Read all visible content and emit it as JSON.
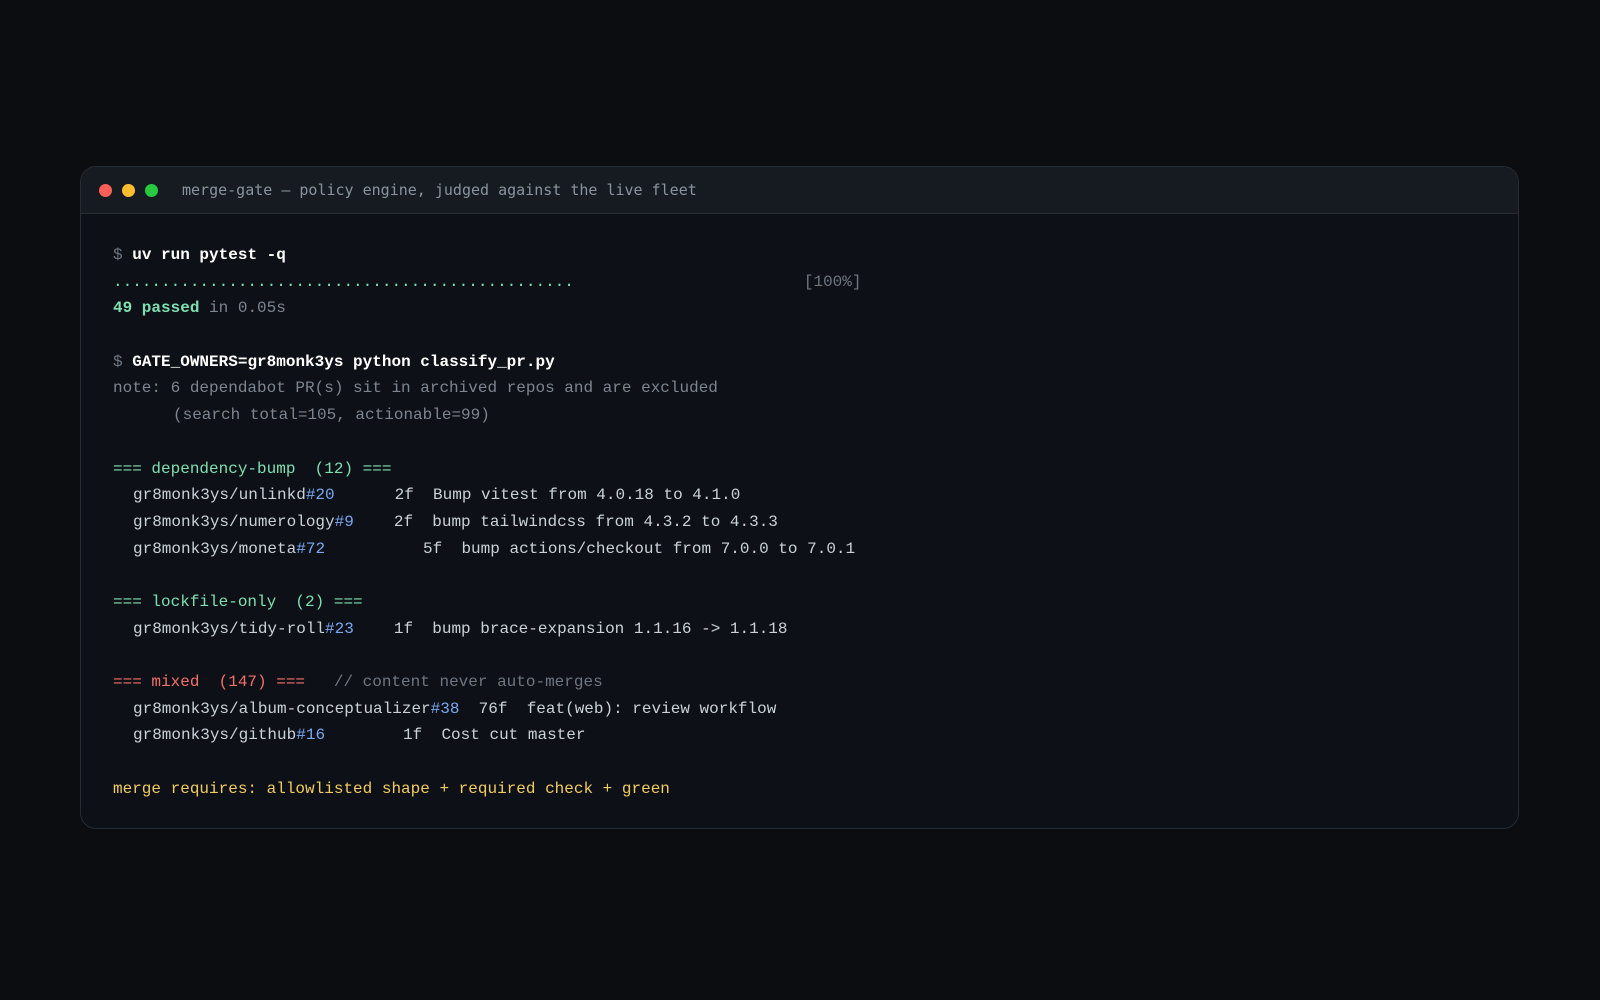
{
  "window": {
    "title": "merge-gate — policy engine, judged against the live fleet"
  },
  "terminal": {
    "prompt": "$",
    "cmd1": "uv run pytest -q",
    "progress_dots": "................................................",
    "progress_pct": "[100%]",
    "passed": "49 passed",
    "passed_time": "in 0.05s",
    "cmd2": "GATE_OWNERS=gr8monk3ys python classify_pr.py",
    "note_line1": "note: 6 dependabot PR(s) sit in archived repos and are excluded",
    "note_line2": "(search total=105, actionable=99)",
    "groups": {
      "dependency_bump": {
        "header": "=== dependency-bump  (12) ===",
        "rows": [
          {
            "repo": "gr8monk3ys/unlinkd",
            "num": "#20",
            "files": "2f",
            "title": "Bump vitest from 4.0.18 to 4.1.0"
          },
          {
            "repo": "gr8monk3ys/numerology",
            "num": "#9",
            "files": "2f",
            "title": "bump tailwindcss from 4.3.2 to 4.3.3"
          },
          {
            "repo": "gr8monk3ys/moneta",
            "num": "#72",
            "files": "5f",
            "title": "bump actions/checkout from 7.0.0 to 7.0.1"
          }
        ]
      },
      "lockfile_only": {
        "header": "=== lockfile-only  (2) ===",
        "rows": [
          {
            "repo": "gr8monk3ys/tidy-roll",
            "num": "#23",
            "files": "1f",
            "title": "bump brace-expansion 1.1.16 -> 1.1.18"
          }
        ]
      },
      "mixed": {
        "header": "=== mixed  (147) ===",
        "comment": "// content never auto-merges",
        "rows": [
          {
            "repo": "gr8monk3ys/album-conceptualizer",
            "num": "#38",
            "files": "76f",
            "title": "feat(web): review workflow"
          },
          {
            "repo": "gr8monk3ys/github",
            "num": "#16",
            "files": "1f",
            "title": "Cost cut master"
          }
        ]
      }
    },
    "footer": "merge requires: allowlisted shape + required check + green"
  },
  "colors": {
    "background": "#0b0d11",
    "window": "#0d1117",
    "green": "#7ee0b0",
    "blue": "#79a8f0",
    "red": "#f47067",
    "yellow": "#f2cc60"
  }
}
